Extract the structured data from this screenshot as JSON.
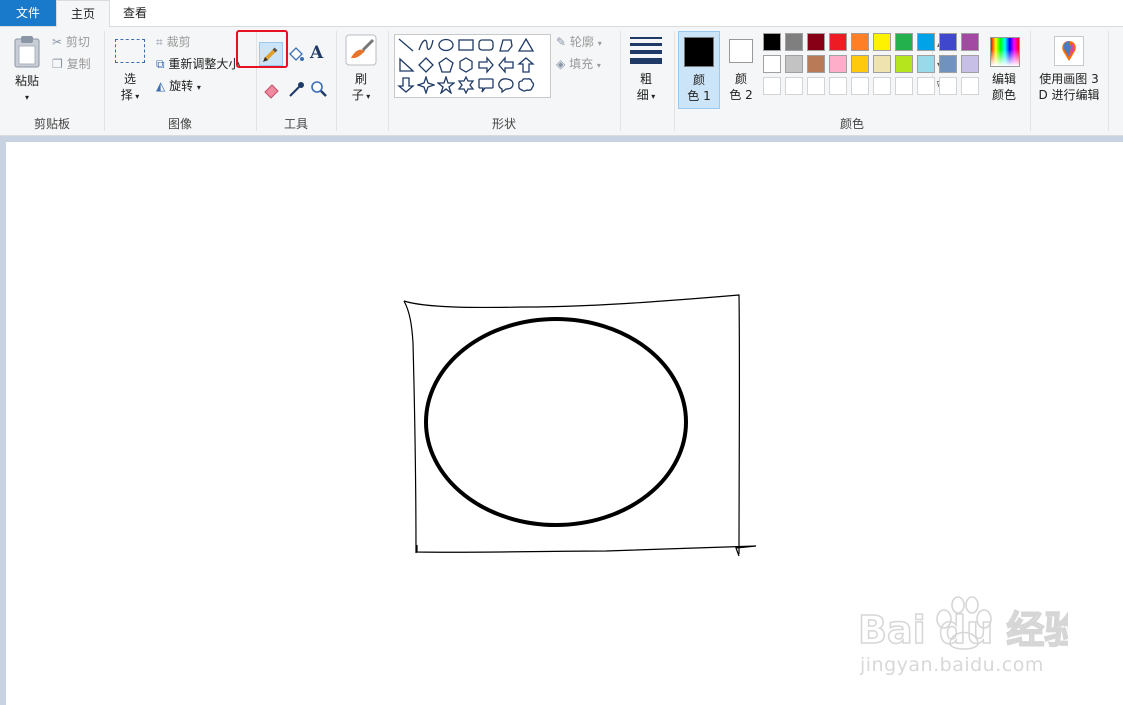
{
  "tabs": {
    "file": "文件",
    "home": "主页",
    "view": "查看"
  },
  "clipboard": {
    "paste": "粘贴",
    "cut": "剪切",
    "copy": "复制",
    "group": "剪贴板"
  },
  "image": {
    "select_top": "选",
    "select_bottom": "择",
    "crop": "裁剪",
    "resize": "重新调整大小",
    "rotate": "旋转",
    "group": "图像"
  },
  "tools": {
    "group": "工具",
    "active_tool": "pencil"
  },
  "brush": {
    "top": "刷",
    "bottom": "子"
  },
  "shapes": {
    "outline": "轮廓",
    "fill": "填充",
    "group": "形状"
  },
  "size": {
    "top": "粗",
    "bottom": "细"
  },
  "colors": {
    "color1_top": "颜",
    "color1_bottom": "色 1",
    "color2_top": "颜",
    "color2_bottom": "色 2",
    "edit_top": "编辑",
    "edit_bottom": "颜色",
    "group": "颜色",
    "color1": "#000000",
    "color2": "#ffffff",
    "row1": [
      "#000000",
      "#7f7f7f",
      "#880015",
      "#ed1c24",
      "#ff7f27",
      "#fff200",
      "#22b14c",
      "#00a2e8",
      "#3f48cc",
      "#a349a4"
    ],
    "row2": [
      "#ffffff",
      "#c3c3c3",
      "#b97a57",
      "#ffaec9",
      "#ffc90e",
      "#efe4b0",
      "#b5e61d",
      "#99d9ea",
      "#7092be",
      "#c8bfe7"
    ]
  },
  "paint3d": {
    "line1": "使用画图 3",
    "line2": "D 进行编辑"
  },
  "accent": "#1979ca",
  "highlight": "#e81123",
  "watermark": {
    "brand": "Bai  du 经验",
    "domain": "jingyan.baidu.com"
  }
}
